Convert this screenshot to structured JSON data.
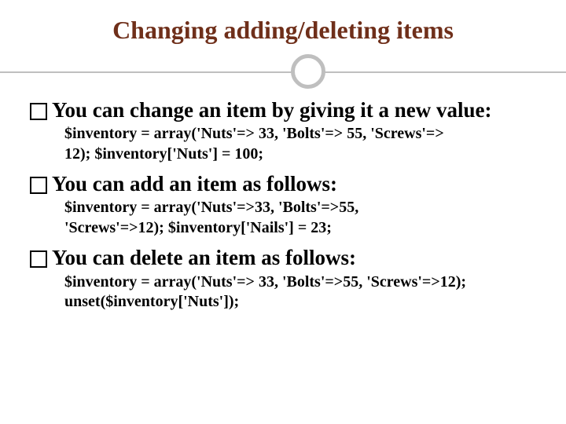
{
  "title": "Changing adding/deleting items",
  "sections": [
    {
      "heading": "You can change an item by giving it a new value:",
      "code": "$inventory = array('Nuts'=> 33, 'Bolts'=> 55, 'Screws'=> 12);\n$inventory['Nuts'] = 100;"
    },
    {
      "heading": "You can add an item as follows:",
      "code": "$inventory = array('Nuts'=>33, 'Bolts'=>55, 'Screws'=>12);\n$inventory['Nails'] = 23;"
    },
    {
      "heading": "You can delete an item as follows:",
      "code": "$inventory = array('Nuts'=> 33, 'Bolts'=>55, 'Screws'=>12);\nunset($inventory['Nuts']);"
    }
  ]
}
